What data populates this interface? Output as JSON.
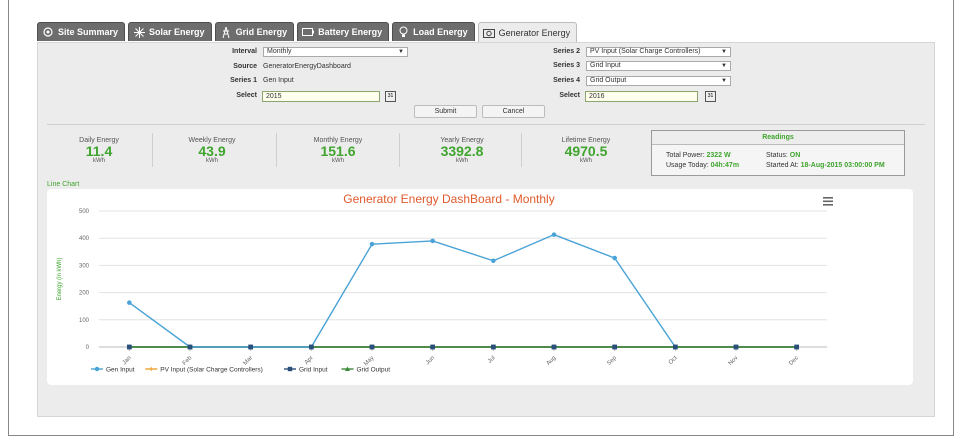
{
  "tabs": [
    {
      "label": "Site Summary",
      "icon": "site-icon"
    },
    {
      "label": "Solar Energy",
      "icon": "sun-icon"
    },
    {
      "label": "Grid Energy",
      "icon": "tower-icon"
    },
    {
      "label": "Battery Energy",
      "icon": "battery-icon"
    },
    {
      "label": "Load Energy",
      "icon": "bulb-icon"
    },
    {
      "label": "Generator Energy",
      "icon": "generator-icon"
    }
  ],
  "form": {
    "interval_label": "Interval",
    "interval_value": "Monthly",
    "source_label": "Source",
    "source_value": "GeneratorEnergyDashboard",
    "series1_label": "Series 1",
    "series1_value": "Gen Input",
    "select_left_label": "Select",
    "select_left_value": "2015",
    "series2_label": "Series 2",
    "series2_value": "PV Input (Solar Charge Controllers)",
    "series3_label": "Series 3",
    "series3_value": "Grid Input",
    "series4_label": "Series 4",
    "series4_value": "Grid Output",
    "select_right_label": "Select",
    "select_right_value": "2016",
    "calendar_text": "31",
    "submit": "Submit",
    "cancel": "Cancel"
  },
  "stats": [
    {
      "title": "Daily Energy",
      "value": "11.4",
      "unit": "kWh"
    },
    {
      "title": "Weekly Energy",
      "value": "43.9",
      "unit": "kWh"
    },
    {
      "title": "Monthly Energy",
      "value": "151.6",
      "unit": "kWh"
    },
    {
      "title": "Yearly Energy",
      "value": "3392.8",
      "unit": "kWh"
    },
    {
      "title": "Lifetime Energy",
      "value": "4970.5",
      "unit": "kWh"
    }
  ],
  "readings": {
    "title": "Readings",
    "total_power_label": "Total Power:",
    "total_power": "2322 W",
    "status_label": "Status:",
    "status": "ON",
    "usage_label": "Usage Today:",
    "usage": "04h:47m",
    "started_label": "Started At:",
    "started": "18-Aug-2015 03:00:00 PM"
  },
  "line_chart_label": "Line Chart",
  "colors": {
    "accent_green": "#3fa52e",
    "title_red": "#e05a2b"
  },
  "chart_data": {
    "type": "line",
    "title": "Generator Energy DashBoard - Monthly",
    "ylabel": "Energy (in kWh)",
    "ylim": [
      0,
      500
    ],
    "yticks": [
      "500",
      "400",
      "300",
      "200",
      "100",
      "0"
    ],
    "categories": [
      "Jan",
      "Feb",
      "Mar",
      "Apr",
      "May",
      "Jun",
      "Jul",
      "Aug",
      "Sep",
      "Oct",
      "Nov",
      "Dec"
    ],
    "series": [
      {
        "name": "Gen Input",
        "color": "#4aa3d6",
        "marker": "circle",
        "values": [
          163,
          0,
          0,
          0,
          378,
          390,
          317,
          413,
          327,
          0,
          null,
          null
        ]
      },
      {
        "name": "PV Input (Solar Charge Controllers)",
        "color": "#f0a030",
        "marker": "cross",
        "values": [
          0,
          0,
          0,
          0,
          0,
          0,
          0,
          0,
          0,
          0,
          0,
          0
        ]
      },
      {
        "name": "Grid Input",
        "color": "#2a4f7a",
        "marker": "square",
        "values": [
          0,
          0,
          0,
          0,
          0,
          0,
          0,
          0,
          0,
          0,
          0,
          0
        ]
      },
      {
        "name": "Grid Output",
        "color": "#3a8a3a",
        "marker": "triangle",
        "values": [
          0,
          0,
          0,
          0,
          0,
          0,
          0,
          0,
          0,
          0,
          0,
          0
        ]
      }
    ],
    "menu_icon": "hamburger-icon"
  }
}
